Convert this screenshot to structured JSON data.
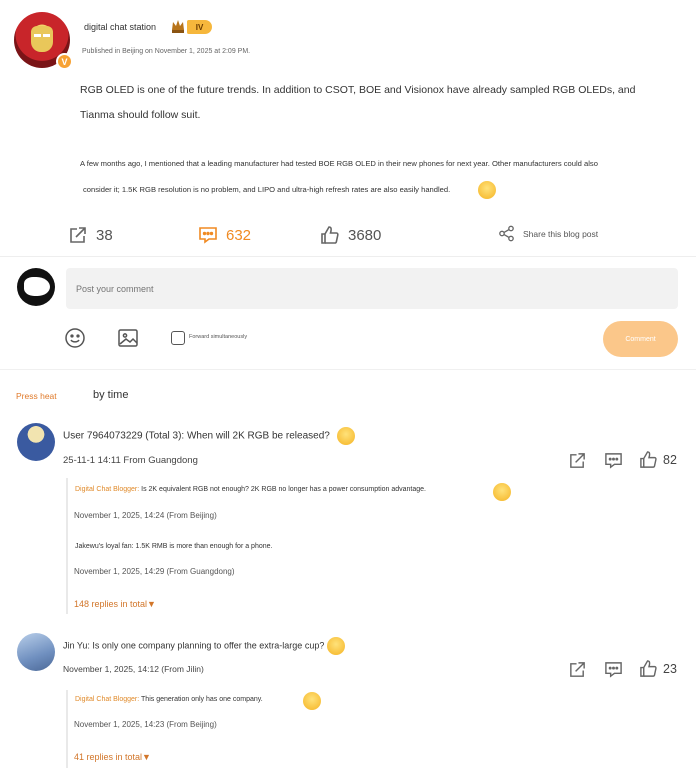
{
  "post": {
    "username": "digital chat station",
    "level": "IV",
    "verified_badge": "V",
    "published": "Published in Beijing on November 1, 2025 at 2:09 PM.",
    "p1_line1": "RGB OLED is one of the future trends. In addition to CSOT, BOE and Visionox have already sampled RGB OLEDs, and",
    "p1_line2": "Tianma should follow suit.",
    "p2_line1": "A few months ago, I mentioned that a leading manufacturer had tested BOE RGB OLED in their new phones for next year. Other manufacturers could also",
    "p2_line2": "consider it; 1.5K RGB resolution is no problem, and LIPO and ultra-high refresh rates are also easily handled."
  },
  "actions": {
    "forward_count": "38",
    "comment_count": "632",
    "like_count": "3680",
    "share_label": "Share this blog post"
  },
  "composer": {
    "placeholder": "Post your comment",
    "forward_label": "Forward simultaneously",
    "submit_label": "Comment"
  },
  "sort": {
    "heat_label": "Press heat",
    "time_label": "by time"
  },
  "comments": [
    {
      "text": "User 7964073229 (Total 3): When will 2K RGB be released?",
      "meta": "25-11-1 14:11 From Guangdong",
      "likes": "82",
      "replies": [
        {
          "author": "Digital Chat Blogger:",
          "text": " Is 2K equivalent RGB not enough? 2K RGB no longer has a power consumption advantage.",
          "meta": "November 1, 2025, 14:24 (From Beijing)"
        },
        {
          "author": "Jakewu's loyal fan:",
          "text": " 1.5K RMB is more than enough for a phone.",
          "meta": "November 1, 2025, 14:29 (From Guangdong)"
        }
      ],
      "replies_total": "148 replies in total"
    },
    {
      "text": "Jin Yu: Is only one company planning to offer the extra-large cup?",
      "meta": "November 1, 2025, 14:12 (From Jilin)",
      "likes": "23",
      "replies": [
        {
          "author": "Digital Chat Blogger:",
          "text": " This generation only has one company.",
          "meta": "November 1, 2025, 14:23 (From Beijing)"
        }
      ],
      "replies_total": "41 replies in total"
    }
  ],
  "colors": {
    "accent": "#f08a22",
    "button": "#fbc78a",
    "input_bg": "#f2f2f2"
  }
}
